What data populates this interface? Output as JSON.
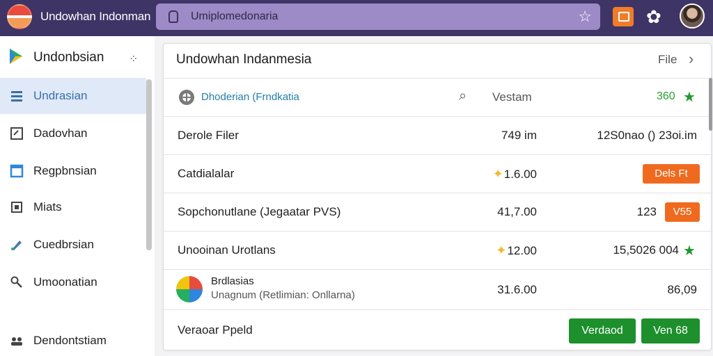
{
  "topbar": {
    "title": "Undowhan Indonman",
    "url": "Umiplomedonaria",
    "bookmark_icon": "star-icon",
    "extension_icon": "window-icon",
    "settings_icon": "gear-icon",
    "profile_icon": "avatar"
  },
  "sidebar": {
    "title": "Undonbsian",
    "items": [
      {
        "label": "Undrasian",
        "icon": "list-icon",
        "active": true
      },
      {
        "label": "Dadovhan",
        "icon": "edit-icon"
      },
      {
        "label": "Regpbnsian",
        "icon": "window-icon"
      },
      {
        "label": "Miats",
        "icon": "media-icon"
      },
      {
        "label": "Cuedbrsian",
        "icon": "pen-icon"
      },
      {
        "label": "Umoonatian",
        "icon": "key-icon"
      },
      {
        "label": "Dendontstiam",
        "icon": "group-icon"
      }
    ]
  },
  "main": {
    "title": "Undowhan Indanmesia",
    "header_link": "File",
    "filter_row": {
      "label": "Dhoderian (Frndkatia",
      "column": "Vestam",
      "value": "360"
    },
    "rows": [
      {
        "name": "Derole Filer",
        "mid": "749 im",
        "right": "12S0nao () 23oi.im"
      },
      {
        "name": "Catdialalar",
        "mid": "1.6.00",
        "tag": "Dels Ft"
      },
      {
        "name": "Sopchonutlane (Jegaatar PVS)",
        "mid": "41,7.00",
        "right": "123",
        "tag": "V55"
      },
      {
        "name": "Unooinan Urotlans",
        "mid": "12.00",
        "right": "15,5026 004"
      },
      {
        "name": "Brdlasias",
        "desc": "Unagnum (Retlimian: Onllarna)",
        "mid": "31.6.00",
        "right": "86,09"
      }
    ],
    "footer": {
      "label": "Veraoar Ppeld",
      "button1": "Verdaod",
      "button2": "Ven 68"
    }
  },
  "colors": {
    "topbar": "#3f3466",
    "accent_orange": "#ef6a1f",
    "accent_green": "#1d8f2d",
    "sidebar_active": "#dfe9f8"
  }
}
